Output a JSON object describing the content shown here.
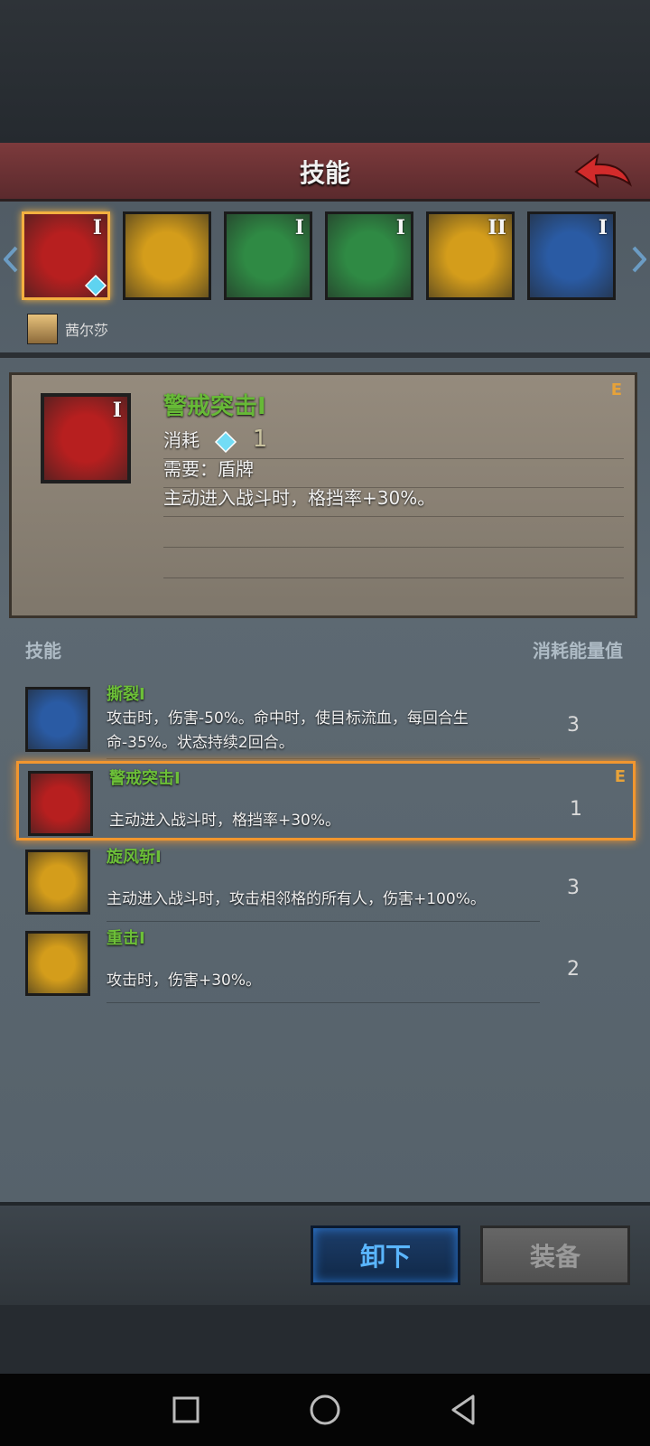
{
  "header": {
    "title": "技能"
  },
  "skill_slots": [
    {
      "icon": "shield-bash-icon",
      "rank": "I",
      "bg": "#b71f1f"
    },
    {
      "icon": "sword-totem-icon",
      "rank": "",
      "bg": "#d49d1b"
    },
    {
      "icon": "shatter-icon",
      "rank": "I",
      "bg": "#2f8a44"
    },
    {
      "icon": "claw-icon",
      "rank": "I",
      "bg": "#2f8a44"
    },
    {
      "icon": "crossed-swords-icon",
      "rank": "II",
      "bg": "#d49d1b"
    },
    {
      "icon": "crossed-swords-icon",
      "rank": "I",
      "bg": "#2a5ba4"
    }
  ],
  "owner": {
    "name": "茜尔莎"
  },
  "detail": {
    "title": "警戒突击Ⅰ",
    "rank": "I",
    "grade": "E",
    "cost_label": "消耗",
    "cost_value": "1",
    "requirement": "需要：盾牌",
    "description": "主动进入战斗时，格挡率+30%。"
  },
  "list_header": {
    "left": "技能",
    "right": "消耗能量值"
  },
  "skills": [
    {
      "name": "撕裂Ⅰ",
      "desc": "攻击时，伤害-50%。命中时，使目标流血，每回合生命-35%。状态持续2回合。",
      "cost": "3",
      "grade": "",
      "icon": "rend-icon",
      "bg": "#2a5ba4"
    },
    {
      "name": "警戒突击Ⅰ",
      "desc": "主动进入战斗时，格挡率+30%。",
      "cost": "1",
      "grade": "E",
      "icon": "shield-bash-icon",
      "bg": "#b71f1f"
    },
    {
      "name": "旋风斩Ⅰ",
      "desc": "主动进入战斗时，攻击相邻格的所有人，伤害+100%。",
      "cost": "3",
      "grade": "",
      "icon": "whirlwind-icon",
      "bg": "#d49d1b"
    },
    {
      "name": "重击Ⅰ",
      "desc": "攻击时，伤害+30%。",
      "cost": "2",
      "grade": "",
      "icon": "heavy-strike-icon",
      "bg": "#d49d1b"
    }
  ],
  "buttons": {
    "unequip": "卸下",
    "equip": "装备"
  }
}
